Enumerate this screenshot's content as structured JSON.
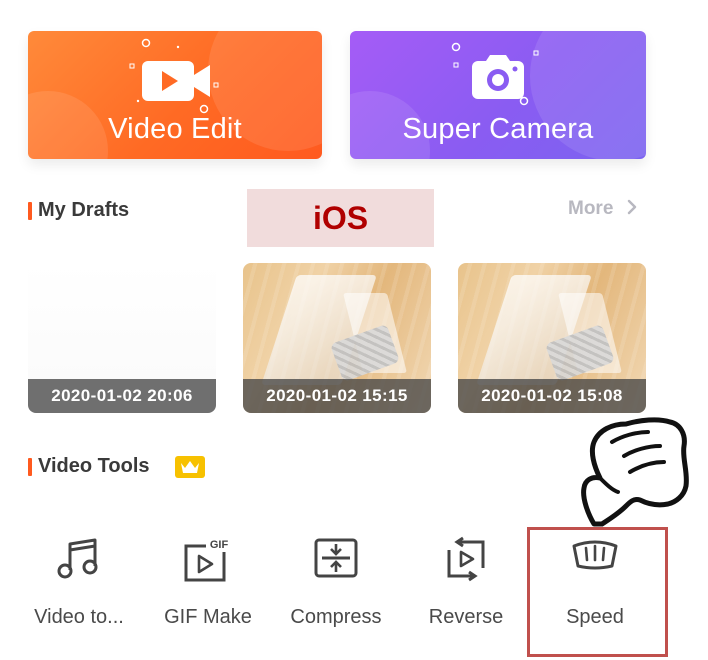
{
  "cards": [
    {
      "title": "Video Edit",
      "icon": "video-camera-icon",
      "color": "#ff6a24"
    },
    {
      "title": "Super Camera",
      "icon": "camera-icon",
      "color": "#8a5cf2"
    }
  ],
  "drafts_section": {
    "title": "My Drafts",
    "more_label": "More",
    "items": [
      {
        "timestamp": "2020-01-02 20:06"
      },
      {
        "timestamp": "2020-01-02 15:15"
      },
      {
        "timestamp": "2020-01-02 15:08"
      }
    ]
  },
  "overlay": {
    "platform_label": "iOS"
  },
  "tools_section": {
    "title": "Video Tools",
    "badge_icon": "crown-icon",
    "items": [
      {
        "label": "Video to...",
        "icon": "music-note-icon"
      },
      {
        "label": "GIF Make",
        "icon": "gif-icon",
        "icon_text": "GIF"
      },
      {
        "label": "Compress",
        "icon": "compress-icon"
      },
      {
        "label": "Reverse",
        "icon": "reverse-icon"
      },
      {
        "label": "Speed",
        "icon": "speedometer-icon"
      }
    ]
  },
  "colors": {
    "accent": "#ff5a1f",
    "highlight_border": "#c0504d",
    "more_text": "#b8b8c0"
  }
}
